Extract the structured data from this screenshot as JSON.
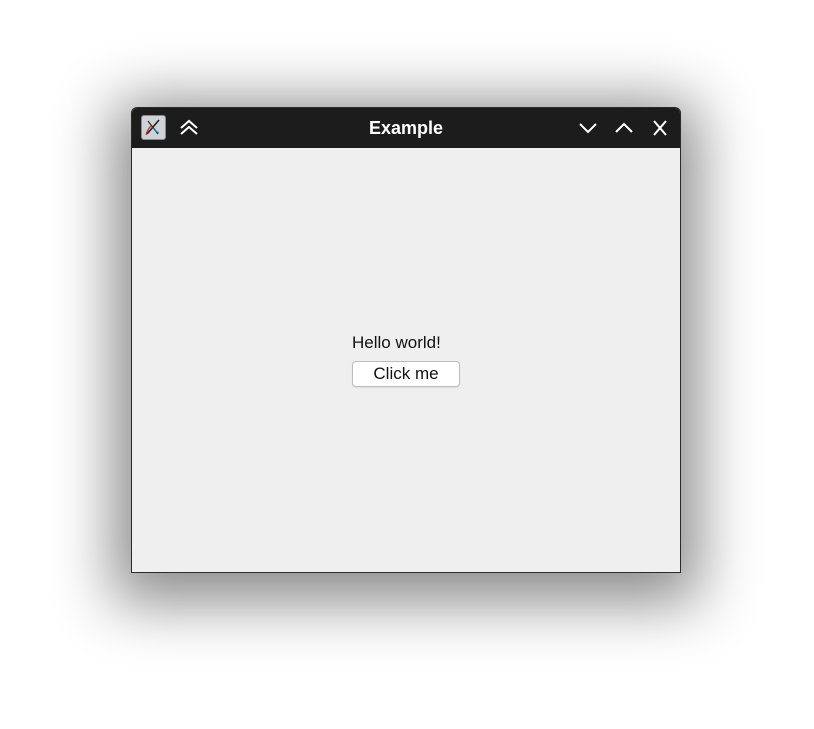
{
  "window": {
    "title": "Example",
    "app_icon": "tk-feather-icon",
    "buttons": {
      "shade": "double-chevron-up-icon",
      "minimize": "chevron-down-icon",
      "maximize": "chevron-up-icon",
      "close": "close-icon"
    }
  },
  "content": {
    "label_text": "Hello world!",
    "button_label": "Click me"
  },
  "colors": {
    "titlebar": "#1c1c1c",
    "title_text": "#ffffff",
    "content_bg": "#efefef",
    "button_bg": "#ffffff"
  }
}
